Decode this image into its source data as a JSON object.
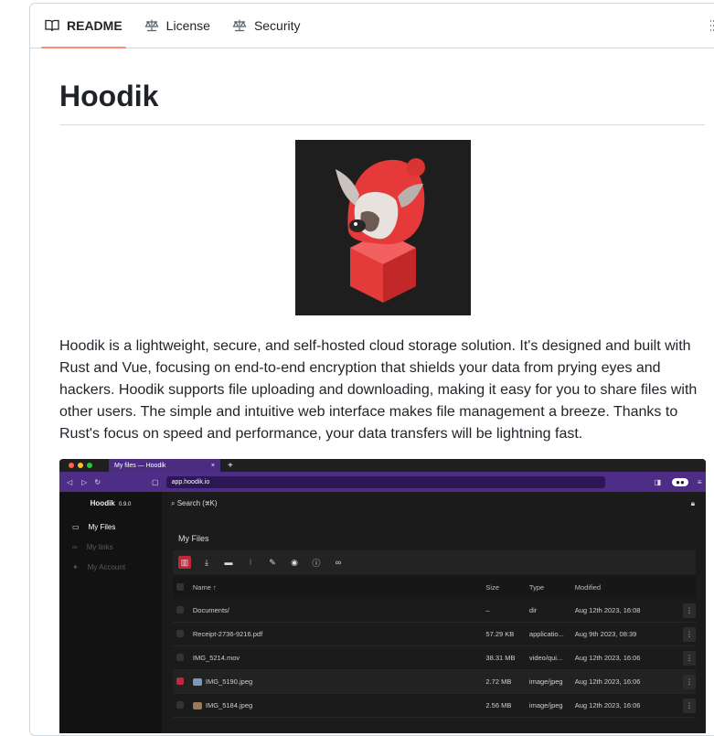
{
  "tabs": [
    {
      "label": "README",
      "icon": "book-icon"
    },
    {
      "label": "License",
      "icon": "scale-icon"
    },
    {
      "label": "Security",
      "icon": "scale-icon"
    }
  ],
  "readme": {
    "title": "Hoodik",
    "description": "Hoodik is a lightweight, secure, and self-hosted cloud storage solution. It's designed and built with Rust and Vue, focusing on end-to-end encryption that shields your data from prying eyes and hackers. Hoodik supports file uploading and downloading, making it easy for you to share files with other users. The simple and intuitive web interface makes file management a breeze. Thanks to Rust's focus on speed and performance, your data transfers will be lightning fast."
  },
  "screenshot": {
    "browser_tab": "My files — Hoodik",
    "url": "app.hoodik.io",
    "app_name": "Hoodik",
    "version": "0.9.0",
    "search": "Search (⌘K)",
    "section_title": "My Files",
    "sidebar": [
      {
        "label": "My Files",
        "active": true
      },
      {
        "label": "My links",
        "active": false
      },
      {
        "label": "My Account",
        "active": false
      }
    ],
    "columns": {
      "name": "Name ↑",
      "size": "Size",
      "type": "Type",
      "modified": "Modified"
    },
    "rows": [
      {
        "name": "Documents/",
        "size": "–",
        "type": "dir",
        "modified": "Aug 12th 2023, 16:08",
        "checked": false
      },
      {
        "name": "Receipt-2736-9216.pdf",
        "size": "57.29 KB",
        "type": "applicatio...",
        "modified": "Aug 9th 2023, 08:39",
        "checked": false
      },
      {
        "name": "IMG_5214.mov",
        "size": "38.31 MB",
        "type": "video/qui...",
        "modified": "Aug 12th 2023, 16:06",
        "checked": false
      },
      {
        "name": "IMG_5190.jpeg",
        "size": "2.72 MB",
        "type": "image/jpeg",
        "modified": "Aug 12th 2023, 16:06",
        "checked": true
      },
      {
        "name": "IMG_5184.jpeg",
        "size": "2.56 MB",
        "type": "image/jpeg",
        "modified": "Aug 12th 2023, 16:06",
        "checked": false
      }
    ]
  },
  "colors": {
    "accent": "#fd8c73",
    "browser_purple": "#4d2d85",
    "danger": "#c0273b"
  }
}
